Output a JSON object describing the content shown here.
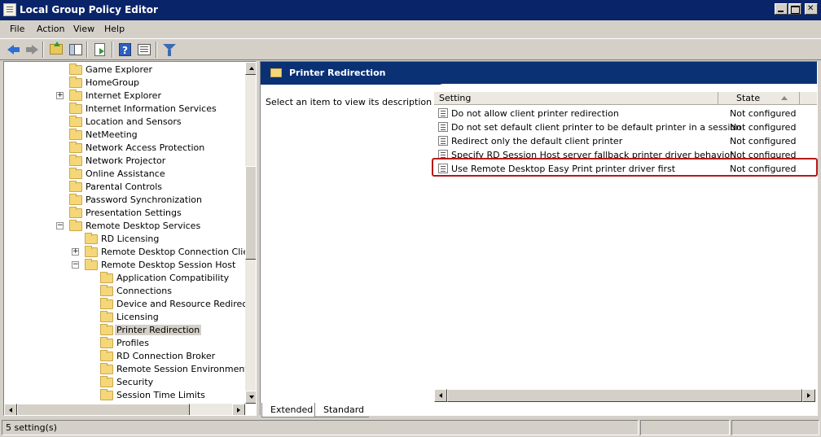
{
  "window": {
    "title": "Local Group Policy Editor"
  },
  "menu": [
    "File",
    "Action",
    "View",
    "Help"
  ],
  "tree": {
    "items": [
      {
        "label": "Game Explorer",
        "level": 1,
        "expander": ""
      },
      {
        "label": "HomeGroup",
        "level": 1,
        "expander": ""
      },
      {
        "label": "Internet Explorer",
        "level": 1,
        "expander": "+"
      },
      {
        "label": "Internet Information Services",
        "level": 1,
        "expander": ""
      },
      {
        "label": "Location and Sensors",
        "level": 1,
        "expander": ""
      },
      {
        "label": "NetMeeting",
        "level": 1,
        "expander": ""
      },
      {
        "label": "Network Access Protection",
        "level": 1,
        "expander": ""
      },
      {
        "label": "Network Projector",
        "level": 1,
        "expander": ""
      },
      {
        "label": "Online Assistance",
        "level": 1,
        "expander": ""
      },
      {
        "label": "Parental Controls",
        "level": 1,
        "expander": ""
      },
      {
        "label": "Password Synchronization",
        "level": 1,
        "expander": ""
      },
      {
        "label": "Presentation Settings",
        "level": 1,
        "expander": ""
      },
      {
        "label": "Remote Desktop Services",
        "level": 1,
        "expander": "-"
      },
      {
        "label": "RD Licensing",
        "level": 2,
        "expander": ""
      },
      {
        "label": "Remote Desktop Connection Client",
        "level": 2,
        "expander": "+"
      },
      {
        "label": "Remote Desktop Session Host",
        "level": 2,
        "expander": "-"
      },
      {
        "label": "Application Compatibility",
        "level": 3,
        "expander": ""
      },
      {
        "label": "Connections",
        "level": 3,
        "expander": ""
      },
      {
        "label": "Device and Resource Redirection",
        "level": 3,
        "expander": ""
      },
      {
        "label": "Licensing",
        "level": 3,
        "expander": ""
      },
      {
        "label": "Printer Redirection",
        "level": 3,
        "expander": "",
        "selected": true
      },
      {
        "label": "Profiles",
        "level": 3,
        "expander": ""
      },
      {
        "label": "RD Connection Broker",
        "level": 3,
        "expander": ""
      },
      {
        "label": "Remote Session Environment",
        "level": 3,
        "expander": ""
      },
      {
        "label": "Security",
        "level": 3,
        "expander": ""
      },
      {
        "label": "Session Time Limits",
        "level": 3,
        "expander": ""
      }
    ]
  },
  "details": {
    "header_title": "Printer Redirection",
    "description": "Select an item to view its description.",
    "columns": {
      "setting": "Setting",
      "state": "State"
    },
    "rows": [
      {
        "setting": "Do not allow client printer redirection",
        "state": "Not configured"
      },
      {
        "setting": "Do not set default client printer to be default printer in a session",
        "state": "Not configured"
      },
      {
        "setting": "Redirect only the default client printer",
        "state": "Not configured"
      },
      {
        "setting": "Specify RD Session Host server fallback printer driver behavior",
        "state": "Not configured"
      },
      {
        "setting": "Use Remote Desktop Easy Print printer driver first",
        "state": "Not configured"
      }
    ],
    "highlighted_row": 4
  },
  "tabs": {
    "extended": "Extended",
    "standard": "Standard",
    "active": "Extended"
  },
  "status": {
    "text": "5 setting(s)"
  },
  "colors": {
    "header_bg": "#0b3175",
    "highlight_border": "#b51a1a"
  }
}
